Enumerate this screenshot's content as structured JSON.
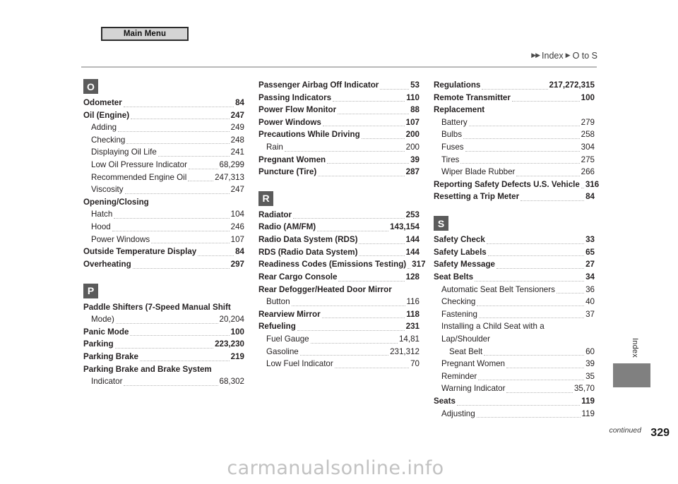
{
  "header": {
    "main_menu_label": "Main Menu",
    "breadcrumb": {
      "arrow_double": "▶▶",
      "index_label": "Index",
      "arrow_single": "▶",
      "range_label": "O to S"
    }
  },
  "side_tab": {
    "label": "Index"
  },
  "footer": {
    "continued_label": "continued",
    "page_number": "329"
  },
  "watermark": {
    "text": "carmanualsonline.info"
  },
  "colors": {
    "letter_badge_bg": "#5b5b5b",
    "letter_badge_text": "#ffffff",
    "button_bg": "#d4d4d4",
    "button_border": "#2b2b2b",
    "rule": "#b9b9b9",
    "side_tab": "#808080",
    "watermark": "#c2c2c2"
  },
  "columns": [
    {
      "sections": [
        {
          "letter": "O",
          "entries": [
            {
              "label": "Odometer",
              "page": "84",
              "level": 0,
              "leader": true
            },
            {
              "label": "Oil (Engine)",
              "page": "247",
              "level": 0,
              "leader": true
            },
            {
              "label": "Adding",
              "page": "249",
              "level": 1,
              "leader": true
            },
            {
              "label": "Checking",
              "page": "248",
              "level": 1,
              "leader": true
            },
            {
              "label": "Displaying Oil Life",
              "page": "241",
              "level": 1,
              "leader": true
            },
            {
              "label": "Low Oil Pressure Indicator",
              "page": "68,299",
              "level": 1,
              "leader": true
            },
            {
              "label": "Recommended Engine Oil",
              "page": "247,313",
              "level": 1,
              "leader": true
            },
            {
              "label": "Viscosity",
              "page": "247",
              "level": 1,
              "leader": true
            },
            {
              "label": "Opening/Closing",
              "page": "",
              "level": 0,
              "leader": false
            },
            {
              "label": "Hatch",
              "page": "104",
              "level": 1,
              "leader": true
            },
            {
              "label": "Hood",
              "page": "246",
              "level": 1,
              "leader": true
            },
            {
              "label": "Power Windows",
              "page": "107",
              "level": 1,
              "leader": true
            },
            {
              "label": "Outside Temperature Display",
              "page": "84",
              "level": 0,
              "leader": true
            },
            {
              "label": "Overheating",
              "page": "297",
              "level": 0,
              "leader": true
            }
          ]
        },
        {
          "letter": "P",
          "entries": [
            {
              "label": "Paddle Shifters (7-Speed Manual Shift",
              "page": "",
              "level": 0,
              "leader": false
            },
            {
              "label": "Mode)",
              "page": "20,204",
              "level": 1,
              "leader": true
            },
            {
              "label": "Panic Mode",
              "page": "100",
              "level": 0,
              "leader": true
            },
            {
              "label": "Parking",
              "page": "223,230",
              "level": 0,
              "leader": true
            },
            {
              "label": "Parking Brake",
              "page": "219",
              "level": 0,
              "leader": true
            },
            {
              "label": "Parking Brake and Brake System",
              "page": "",
              "level": 0,
              "leader": false
            },
            {
              "label": "Indicator",
              "page": "68,302",
              "level": 1,
              "leader": true
            }
          ]
        }
      ]
    },
    {
      "sections": [
        {
          "letter": "",
          "entries": [
            {
              "label": "Passenger Airbag Off Indicator",
              "page": "53",
              "level": 0,
              "leader": true
            },
            {
              "label": "Passing Indicators",
              "page": "110",
              "level": 0,
              "leader": true
            },
            {
              "label": "Power Flow Monitor",
              "page": "88",
              "level": 0,
              "leader": true
            },
            {
              "label": "Power Windows",
              "page": "107",
              "level": 0,
              "leader": true
            },
            {
              "label": "Precautions While Driving",
              "page": "200",
              "level": 0,
              "leader": true
            },
            {
              "label": "Rain",
              "page": "200",
              "level": 1,
              "leader": true
            },
            {
              "label": "Pregnant Women",
              "page": "39",
              "level": 0,
              "leader": true
            },
            {
              "label": "Puncture (Tire)",
              "page": "287",
              "level": 0,
              "leader": true
            }
          ]
        },
        {
          "letter": "R",
          "entries": [
            {
              "label": "Radiator",
              "page": "253",
              "level": 0,
              "leader": true
            },
            {
              "label": "Radio (AM/FM)",
              "page": "143,154",
              "level": 0,
              "leader": true
            },
            {
              "label": "Radio Data System (RDS)",
              "page": "144",
              "level": 0,
              "leader": true
            },
            {
              "label": "RDS (Radio Data System)",
              "page": "144",
              "level": 0,
              "leader": true
            },
            {
              "label": "Readiness Codes (Emissions Testing)",
              "page": "317",
              "level": 0,
              "leader": true
            },
            {
              "label": "Rear Cargo Console",
              "page": "128",
              "level": 0,
              "leader": true
            },
            {
              "label": "Rear Defogger/Heated Door Mirror",
              "page": "",
              "level": 0,
              "leader": false
            },
            {
              "label": "Button",
              "page": "116",
              "level": 1,
              "leader": true
            },
            {
              "label": "Rearview Mirror",
              "page": "118",
              "level": 0,
              "leader": true
            },
            {
              "label": "Refueling",
              "page": "231",
              "level": 0,
              "leader": true
            },
            {
              "label": "Fuel Gauge",
              "page": "14,81",
              "level": 1,
              "leader": true
            },
            {
              "label": "Gasoline",
              "page": "231,312",
              "level": 1,
              "leader": true
            },
            {
              "label": "Low Fuel Indicator",
              "page": "70",
              "level": 1,
              "leader": true
            }
          ]
        }
      ]
    },
    {
      "sections": [
        {
          "letter": "",
          "entries": [
            {
              "label": "Regulations",
              "page": "217,272,315",
              "level": 0,
              "leader": true
            },
            {
              "label": "Remote Transmitter",
              "page": "100",
              "level": 0,
              "leader": true
            },
            {
              "label": "Replacement",
              "page": "",
              "level": 0,
              "leader": false
            },
            {
              "label": "Battery",
              "page": "279",
              "level": 1,
              "leader": true
            },
            {
              "label": "Bulbs",
              "page": "258",
              "level": 1,
              "leader": true
            },
            {
              "label": "Fuses",
              "page": "304",
              "level": 1,
              "leader": true
            },
            {
              "label": "Tires",
              "page": "275",
              "level": 1,
              "leader": true
            },
            {
              "label": "Wiper Blade Rubber",
              "page": "266",
              "level": 1,
              "leader": true
            },
            {
              "label": "Reporting Safety Defects U.S. Vehicle",
              "page": "316",
              "level": 0,
              "leader": true
            },
            {
              "label": "Resetting a Trip Meter",
              "page": "84",
              "level": 0,
              "leader": true
            }
          ]
        },
        {
          "letter": "S",
          "entries": [
            {
              "label": "Safety Check",
              "page": "33",
              "level": 0,
              "leader": true
            },
            {
              "label": "Safety Labels",
              "page": "65",
              "level": 0,
              "leader": true
            },
            {
              "label": "Safety Message",
              "page": "27",
              "level": 0,
              "leader": true
            },
            {
              "label": "Seat Belts",
              "page": "34",
              "level": 0,
              "leader": true
            },
            {
              "label": "Automatic Seat Belt Tensioners",
              "page": "36",
              "level": 1,
              "leader": true
            },
            {
              "label": "Checking",
              "page": "40",
              "level": 1,
              "leader": true
            },
            {
              "label": "Fastening",
              "page": "37",
              "level": 1,
              "leader": true
            },
            {
              "label": "Installing a Child Seat with a Lap/Shoulder",
              "page": "",
              "level": 1,
              "leader": false
            },
            {
              "label": "Seat Belt",
              "page": "60",
              "level": 2,
              "leader": true
            },
            {
              "label": "Pregnant Women",
              "page": "39",
              "level": 1,
              "leader": true
            },
            {
              "label": "Reminder",
              "page": "35",
              "level": 1,
              "leader": true
            },
            {
              "label": "Warning Indicator",
              "page": "35,70",
              "level": 1,
              "leader": true
            },
            {
              "label": "Seats",
              "page": "119",
              "level": 0,
              "leader": true
            },
            {
              "label": "Adjusting",
              "page": "119",
              "level": 1,
              "leader": true
            }
          ]
        }
      ]
    }
  ]
}
